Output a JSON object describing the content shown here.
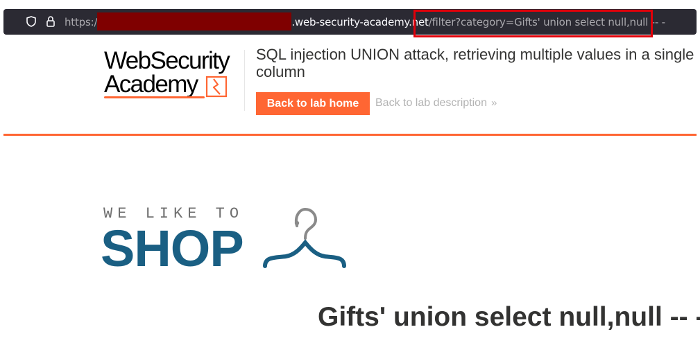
{
  "browser": {
    "url_scheme": "https:/",
    "url_domain": ".web-security-academy.ne",
    "url_domain_tail": "t",
    "url_path": "/filter?category=Gifts' union select null,null -- -",
    "icons": [
      "shield-icon",
      "lock-icon"
    ],
    "highlight_color": "#e0000a",
    "redaction_color": "#7f0000"
  },
  "header": {
    "logo_line1": "WebSecurity",
    "logo_line2": "Academy",
    "lab_title": "SQL injection UNION attack, retrieving multiple values in a single column",
    "back_home_label": "Back to lab home",
    "back_description_label": "Back to lab description",
    "accent_color": "#ff6633"
  },
  "shop": {
    "tagline": "WE LIKE TO",
    "word": "SHOP",
    "brand_color": "#1a5f83"
  },
  "main": {
    "category_heading": "Gifts' union select null,null -- -"
  }
}
